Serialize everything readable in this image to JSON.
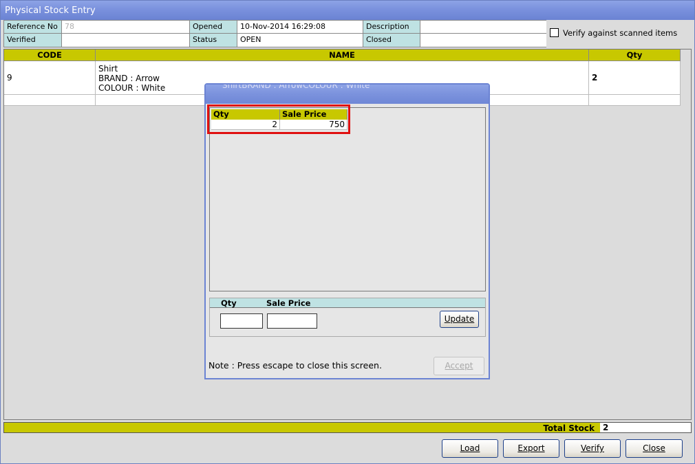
{
  "window": {
    "title": "Physical Stock Entry"
  },
  "info": {
    "reference_label": "Reference No",
    "reference_value": "78",
    "opened_label": "Opened",
    "opened_value": "10-Nov-2014 16:29:08",
    "description_label": "Description",
    "description_value": "",
    "verified_label": "Verified",
    "verified_value": "",
    "status_label": "Status",
    "status_value": "OPEN",
    "closed_label": "Closed",
    "closed_value": ""
  },
  "verify_scanned": {
    "label": "Verify against scanned items",
    "checked": false
  },
  "grid": {
    "columns": [
      "CODE",
      "NAME",
      "Qty"
    ],
    "rows": [
      {
        "code": "9",
        "name_lines": [
          "Shirt",
          "BRAND : Arrow",
          "COLOUR : White"
        ],
        "qty": "2"
      }
    ]
  },
  "total": {
    "label": "Total Stock",
    "value": "2"
  },
  "buttons": {
    "load": "Load",
    "export": "Export",
    "verify": "Verify",
    "close": "Close"
  },
  "dialog": {
    "title": "ShirtBRAND : ArrowCOLOUR : White",
    "list_columns": [
      "Qty",
      "Sale Price"
    ],
    "list_rows": [
      {
        "qty": "2",
        "sale_price": "750"
      }
    ],
    "edit_labels": {
      "qty": "Qty",
      "sale_price": "Sale Price"
    },
    "edit_values": {
      "qty": "",
      "sale_price": ""
    },
    "update_label": "Update",
    "note": "Note : Press escape to close this screen.",
    "accept_label": "Accept"
  },
  "colors": {
    "title_blue": "#7a91dd",
    "header_yellow": "#c8c800",
    "label_cyan": "#bfe2e3",
    "highlight_red": "#e01010"
  }
}
